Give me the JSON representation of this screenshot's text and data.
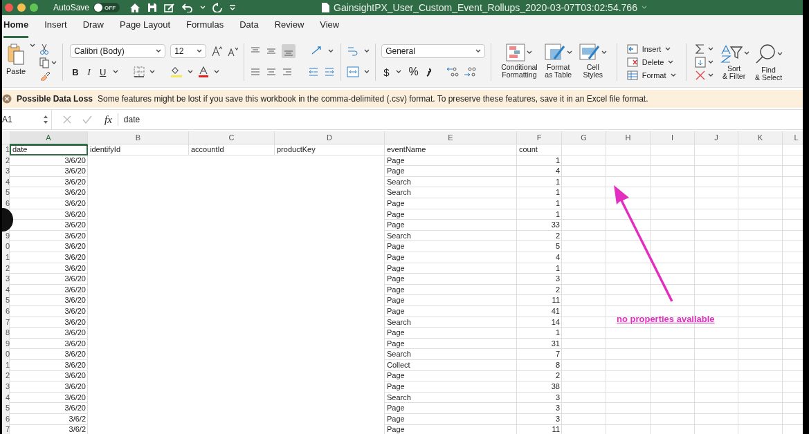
{
  "window": {
    "title": "GainsightPX_User_Custom_Event_Rollups_2020-03-07T03:02:54.766",
    "autosave_label": "AutoSave",
    "autosave": {
      "on": false,
      "label": "OFF"
    }
  },
  "tabs": [
    {
      "label": "Home",
      "selected": true
    },
    {
      "label": "Insert",
      "selected": false
    },
    {
      "label": "Draw",
      "selected": false
    },
    {
      "label": "Page Layout",
      "selected": false
    },
    {
      "label": "Formulas",
      "selected": false
    },
    {
      "label": "Data",
      "selected": false
    },
    {
      "label": "Review",
      "selected": false
    },
    {
      "label": "View",
      "selected": false
    }
  ],
  "ribbon": {
    "paste": "Paste",
    "font_name": "Calibri (Body)",
    "font_size": "12",
    "style_buttons": [
      "B",
      "I",
      "U"
    ],
    "number_format": "General",
    "number_buttons": [
      "$",
      "%"
    ],
    "styles": [
      "Conditional Formatting",
      "Format as Table",
      "Cell Styles"
    ],
    "cells": [
      "Insert",
      "Delete",
      "Format"
    ],
    "editing": [
      "Sort & Filter",
      "Find & Select"
    ]
  },
  "banner": {
    "title": "Possible Data Loss",
    "message": "Some features might be lost if you save this workbook in the comma-delimited (.csv) format. To preserve these features, save it in an Excel file format."
  },
  "formula_bar": {
    "name_box": "A1",
    "function_label": "fx",
    "value": "date"
  },
  "sheet": {
    "columns": [
      {
        "label": "A",
        "selected": true
      },
      {
        "label": "B",
        "selected": false
      },
      {
        "label": "C",
        "selected": false
      },
      {
        "label": "D",
        "selected": false
      },
      {
        "label": "E",
        "selected": false
      },
      {
        "label": "F",
        "selected": false
      },
      {
        "label": "G",
        "selected": false
      },
      {
        "label": "H",
        "selected": false
      },
      {
        "label": "I",
        "selected": false
      },
      {
        "label": "J",
        "selected": false
      },
      {
        "label": "K",
        "selected": false
      },
      {
        "label": "L",
        "selected": false
      }
    ],
    "header_row": {
      "number": "1",
      "cells": [
        "date",
        "identifyId",
        "accountId",
        "productKey",
        "eventName",
        "count"
      ]
    },
    "rows": [
      {
        "number": "2",
        "date": "3/6/20",
        "event": "Page",
        "count": "1"
      },
      {
        "number": "3",
        "date": "3/6/20",
        "event": "Page",
        "count": "4"
      },
      {
        "number": "4",
        "date": "3/6/20",
        "event": "Search",
        "count": "1"
      },
      {
        "number": "5",
        "date": "3/6/20",
        "event": "Search",
        "count": "1"
      },
      {
        "number": "6",
        "date": "3/6/20",
        "event": "Page",
        "count": "1"
      },
      {
        "date": "3/6/20",
        "event": "Page",
        "count": "1"
      },
      {
        "date": "3/6/20",
        "event": "Page",
        "count": "33"
      },
      {
        "number": "9",
        "date": "3/6/20",
        "event": "Search",
        "count": "2"
      },
      {
        "number": "0",
        "date": "3/6/20",
        "event": "Page",
        "count": "5"
      },
      {
        "number": "1",
        "date": "3/6/20",
        "event": "Page",
        "count": "4"
      },
      {
        "number": "2",
        "date": "3/6/20",
        "event": "Page",
        "count": "1"
      },
      {
        "number": "3",
        "date": "3/6/20",
        "event": "Page",
        "count": "3"
      },
      {
        "number": "4",
        "date": "3/6/20",
        "event": "Page",
        "count": "2"
      },
      {
        "number": "5",
        "date": "3/6/20",
        "event": "Page",
        "count": "11"
      },
      {
        "number": "6",
        "date": "3/6/20",
        "event": "Page",
        "count": "41"
      },
      {
        "number": "7",
        "date": "3/6/20",
        "event": "Search",
        "count": "14"
      },
      {
        "number": "8",
        "date": "3/6/20",
        "event": "Page",
        "count": "1"
      },
      {
        "number": "9",
        "date": "3/6/20",
        "event": "Page",
        "count": "31"
      },
      {
        "number": "0",
        "date": "3/6/20",
        "event": "Search",
        "count": "7"
      },
      {
        "number": "1",
        "date": "3/6/20",
        "event": "Collect",
        "count": "8"
      },
      {
        "number": "2",
        "date": "3/6/20",
        "event": "Page",
        "count": "2"
      },
      {
        "number": "3",
        "date": "3/6/20",
        "event": "Page",
        "count": "38"
      },
      {
        "number": "4",
        "date": "3/6/20",
        "event": "Search",
        "count": "3"
      },
      {
        "number": "5",
        "date": "3/6/20",
        "event": "Page",
        "count": "3"
      },
      {
        "number": "6",
        "date": "3/6/2",
        "event": "Page",
        "count": "3"
      },
      {
        "number": "7",
        "date": "3/6/2",
        "event": "Page",
        "count": "11"
      }
    ]
  },
  "annotation": {
    "text": "no properties available"
  }
}
